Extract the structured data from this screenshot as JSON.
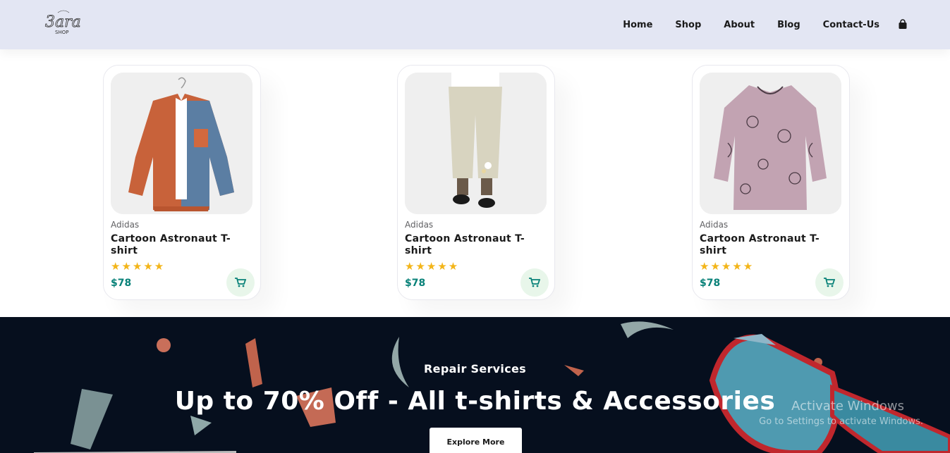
{
  "header": {
    "logo_text": "Cara SHOP",
    "nav": [
      {
        "label": "Home"
      },
      {
        "label": "Shop"
      },
      {
        "label": "About"
      },
      {
        "label": "Blog"
      },
      {
        "label": "Contact-Us"
      }
    ],
    "bag_icon": "shopping-bag-icon"
  },
  "products": [
    {
      "brand": "Adidas",
      "title": "Cartoon Astronaut T-shirt",
      "rating": 5,
      "stars": "★★★★★",
      "price": "$78"
    },
    {
      "brand": "Adidas",
      "title": "Cartoon Astronaut T-shirt",
      "rating": 5,
      "stars": "★★★★★",
      "price": "$78"
    },
    {
      "brand": "Adidas",
      "title": "Cartoon Astronaut T-shirt",
      "rating": 5,
      "stars": "★★★★★",
      "price": "$78"
    }
  ],
  "banner": {
    "subtitle": "Repair Services",
    "headline": "Up to 70% Off - All t-shirts & Accessories",
    "button_label": "Explore More"
  },
  "watermark": {
    "line1": "Activate Windows",
    "line2": "Go to Settings to activate Windows."
  },
  "colors": {
    "header_bg": "#e3e6f3",
    "accent": "#088178",
    "star": "#f3b519",
    "banner_bg": "#060f1e"
  }
}
